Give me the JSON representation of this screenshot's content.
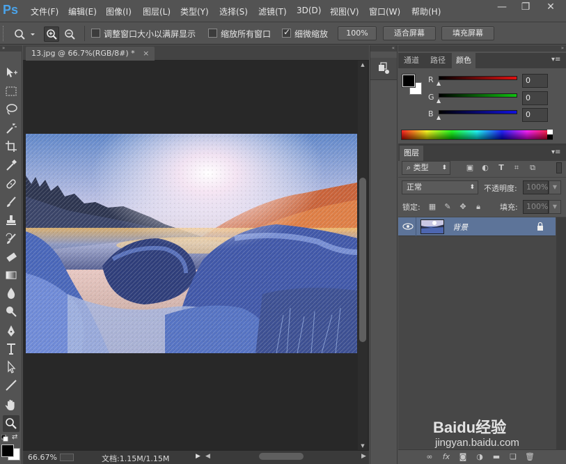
{
  "app": {
    "logo": "Ps"
  },
  "menu": [
    "文件(F)",
    "编辑(E)",
    "图像(I)",
    "图层(L)",
    "类型(Y)",
    "选择(S)",
    "滤镜(T)",
    "3D(D)",
    "视图(V)",
    "窗口(W)",
    "帮助(H)"
  ],
  "window_controls": {
    "minimize": "—",
    "restore": "❐",
    "close": "✕"
  },
  "options_bar": {
    "resize_windows": {
      "label": "调整窗口大小以满屏显示",
      "checked": false
    },
    "zoom_all": {
      "label": "缩放所有窗口",
      "checked": false
    },
    "scrubby_zoom": {
      "label": "细微缩放",
      "checked": true
    },
    "btn_100": "100%",
    "btn_fit": "适合屏幕",
    "btn_fill": "填充屏幕"
  },
  "document": {
    "tab_title": "13.jpg @ 66.7%(RGB/8#) *",
    "tab_close": "×",
    "zoom": "66.67%",
    "doc_size": "文档:1.15M/1.15M"
  },
  "color_panel": {
    "tabs": [
      "通道",
      "路径",
      "颜色"
    ],
    "active_tab": "颜色",
    "channels": [
      {
        "label": "R",
        "value": "0",
        "color": "#e01010"
      },
      {
        "label": "G",
        "value": "0",
        "color": "#10c010"
      },
      {
        "label": "B",
        "value": "0",
        "color": "#1010e0"
      }
    ],
    "foreground": "#000000",
    "background": "#ffffff"
  },
  "layers_panel": {
    "tab": "图层",
    "filter_kind": "类型",
    "blend_mode": "正常",
    "opacity_label": "不透明度:",
    "opacity_value": "100%",
    "lock_label": "锁定:",
    "fill_label": "填充:",
    "fill_value": "100%",
    "layers": [
      {
        "name": "背景",
        "visible": true,
        "locked": true
      }
    ]
  },
  "watermark": {
    "text": "Baidu经验",
    "sub": "jingyan.baidu.com"
  }
}
